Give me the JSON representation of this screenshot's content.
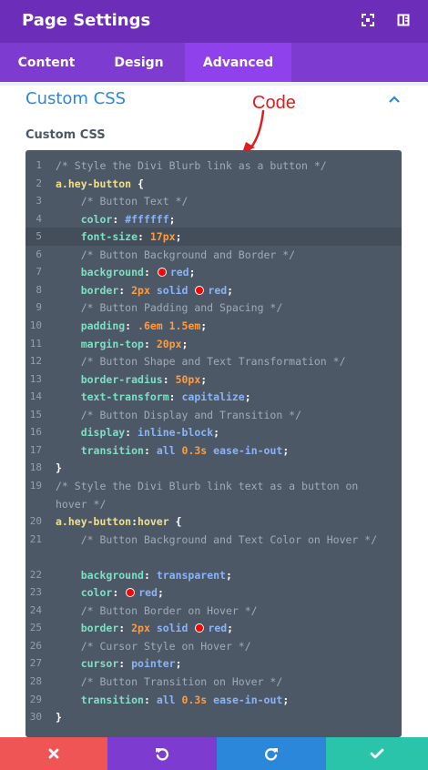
{
  "header": {
    "title": "Page Settings"
  },
  "tabs": [
    {
      "label": "Content"
    },
    {
      "label": "Design"
    },
    {
      "label": "Advanced"
    }
  ],
  "section": {
    "title": "Custom CSS",
    "field_label": "Custom CSS"
  },
  "annotation": {
    "text": "Code"
  },
  "editor": {
    "lines": [
      {
        "num": "1",
        "code": "/* Style the Divi Blurb link as a button */"
      },
      {
        "num": "2",
        "code": "a.hey-button {"
      },
      {
        "num": "3",
        "code": "    /* Button Text */"
      },
      {
        "num": "4",
        "code": "    color: #ffffff;"
      },
      {
        "num": "5",
        "code": "    font-size: 17px;"
      },
      {
        "num": "6",
        "code": "    /* Button Background and Border */"
      },
      {
        "num": "7",
        "code": "    background: red;"
      },
      {
        "num": "8",
        "code": "    border: 2px solid red;"
      },
      {
        "num": "9",
        "code": "    /* Button Padding and Spacing */"
      },
      {
        "num": "10",
        "code": "    padding: .6em 1.5em;"
      },
      {
        "num": "11",
        "code": "    margin-top: 20px;"
      },
      {
        "num": "12",
        "code": "    /* Button Shape and Text Transformation */"
      },
      {
        "num": "13",
        "code": "    border-radius: 50px;"
      },
      {
        "num": "14",
        "code": "    text-transform: capitalize;"
      },
      {
        "num": "15",
        "code": "    /* Button Display and Transition */"
      },
      {
        "num": "16",
        "code": "    display: inline-block;"
      },
      {
        "num": "17",
        "code": "    transition: all 0.3s ease-in-out;"
      },
      {
        "num": "18",
        "code": "}"
      },
      {
        "num": "19",
        "code": "/* Style the Divi Blurb link text as a button on hover */"
      },
      {
        "num": "20",
        "code": "a.hey-button:hover {"
      },
      {
        "num": "21",
        "code": "    /* Button Background and Text Color on Hover */"
      },
      {
        "num": "22",
        "code": "    background: transparent;"
      },
      {
        "num": "23",
        "code": "    color: red;"
      },
      {
        "num": "24",
        "code": "    /* Button Border on Hover */"
      },
      {
        "num": "25",
        "code": "    border: 2px solid red;"
      },
      {
        "num": "26",
        "code": "    /* Cursor Style on Hover */"
      },
      {
        "num": "27",
        "code": "    cursor: pointer;"
      },
      {
        "num": "28",
        "code": "    /* Button Transition on Hover */"
      },
      {
        "num": "29",
        "code": "    transition: all 0.3s ease-in-out;"
      },
      {
        "num": "30",
        "code": "}"
      }
    ]
  },
  "footer": {
    "buttons": [
      {
        "icon": "close-icon",
        "color": "#ef5555"
      },
      {
        "icon": "undo-icon",
        "color": "#7e3bd0"
      },
      {
        "icon": "redo-icon",
        "color": "#2b87da"
      },
      {
        "icon": "check-icon",
        "color": "#29c4a9"
      }
    ]
  },
  "colors": {
    "header_bg": "#6c2eb9",
    "tabs_bg": "#7e3bd0",
    "active_tab_bg": "#8f42ec",
    "section_title": "#2b87da",
    "editor_bg": "#4c5866",
    "annotation": "#e01c1c"
  }
}
